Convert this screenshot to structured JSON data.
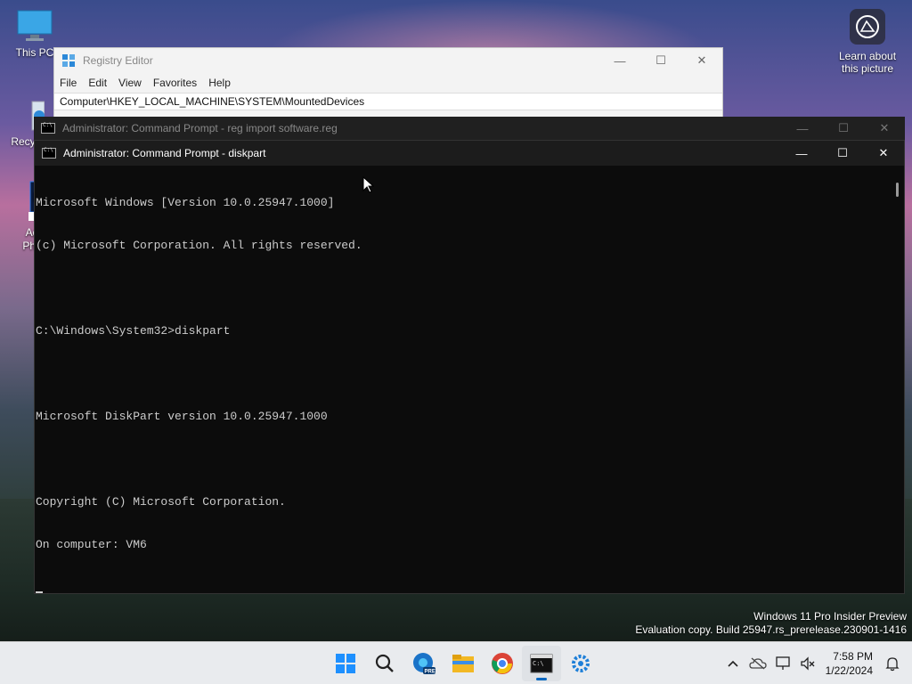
{
  "desktop": {
    "icons": [
      {
        "label": "This PC",
        "icon": "monitor-icon"
      },
      {
        "label": "Recyc",
        "icon": "recycle-bin-icon"
      },
      {
        "label": "Ado\nPhot",
        "icon": "photoshop-icon"
      }
    ],
    "learn_about": {
      "label": "Learn about this picture",
      "icon": "camera-icon"
    }
  },
  "registry_editor": {
    "title": "Registry Editor",
    "menu": [
      "File",
      "Edit",
      "View",
      "Favorites",
      "Help"
    ],
    "address": "Computer\\HKEY_LOCAL_MACHINE\\SYSTEM\\MountedDevices"
  },
  "cmd_back": {
    "title": "Administrator: Command Prompt - reg  import software.reg"
  },
  "cmd": {
    "title": "Administrator: Command Prompt - diskpart",
    "lines": [
      "Microsoft Windows [Version 10.0.25947.1000]",
      "(c) Microsoft Corporation. All rights reserved.",
      "",
      "C:\\Windows\\System32>diskpart",
      "",
      "Microsoft DiskPart version 10.0.25947.1000",
      "",
      "Copyright (C) Microsoft Corporation.",
      "On computer: VM6"
    ]
  },
  "watermark": {
    "line1": "Windows 11 Pro Insider Preview",
    "line2": "Evaluation copy. Build 25947.rs_prerelease.230901-1416"
  },
  "taskbar": {
    "apps": [
      "start-icon",
      "search-icon",
      "edge-beta-icon",
      "file-explorer-icon",
      "chrome-icon",
      "terminal-icon",
      "settings-app-icon"
    ],
    "time": "7:58 PM",
    "date": "1/22/2024"
  },
  "colors": {
    "console_bg": "#0c0c0c",
    "console_fg": "#cccccc",
    "taskbar_bg": "#e9ebee",
    "accent": "#0067c0"
  }
}
